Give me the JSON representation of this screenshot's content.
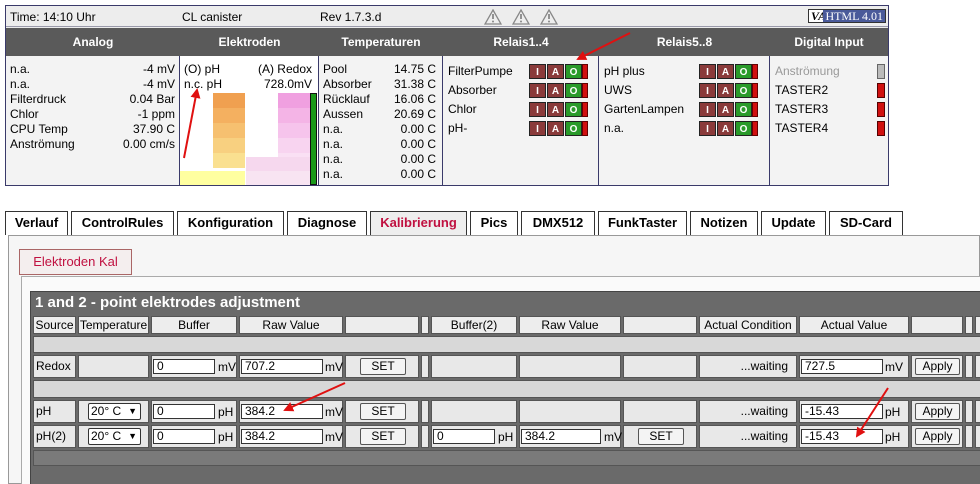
{
  "header": {
    "time": "Time: 14:10 Uhr",
    "device": "CL canister",
    "rev": "Rev 1.7.3.d",
    "badge_v": "VALIDONE",
    "badge_h": "HTML 4.01"
  },
  "panels": {
    "analog": "Analog",
    "elektroden": "Elektroden",
    "temperaturen": "Temperaturen",
    "relais14": "Relais1..4",
    "relais58": "Relais5..8",
    "digital": "Digital Input"
  },
  "analog": [
    {
      "label": "n.a.",
      "value": "-4 mV"
    },
    {
      "label": "n.a.",
      "value": "-4 mV"
    },
    {
      "label": "Filterdruck",
      "value": "0.04 Bar"
    },
    {
      "label": "Chlor",
      "value": "-1 ppm"
    },
    {
      "label": "CPU Temp",
      "value": "37.90 C"
    },
    {
      "label": "Anströmung",
      "value": "0.00 cm/s"
    }
  ],
  "elektroden": {
    "o_ph": "(O) pH",
    "a_redox": "(A) Redox",
    "nc_ph": "n.c. pH",
    "redox_value": "728.0mV"
  },
  "temperaturen": [
    {
      "label": "Pool",
      "value": "14.75 C"
    },
    {
      "label": "Absorber",
      "value": "31.38 C"
    },
    {
      "label": "Rücklauf",
      "value": "16.06 C"
    },
    {
      "label": "Aussen",
      "value": "20.69 C"
    },
    {
      "label": "n.a.",
      "value": "0.00 C"
    },
    {
      "label": "n.a.",
      "value": "0.00 C"
    },
    {
      "label": "n.a.",
      "value": "0.00 C"
    },
    {
      "label": "n.a.",
      "value": "0.00 C"
    }
  ],
  "relais14": [
    "FilterPumpe",
    "Absorber",
    "Chlor",
    "pH-"
  ],
  "relais58": [
    "pH plus",
    "UWS",
    "GartenLampen",
    "n.a."
  ],
  "iao": {
    "i": "I",
    "a": "A",
    "o": "O"
  },
  "digital": [
    {
      "label": "Anströmung",
      "active": false
    },
    {
      "label": "TASTER2",
      "active": true
    },
    {
      "label": "TASTER3",
      "active": true
    },
    {
      "label": "TASTER4",
      "active": true
    }
  ],
  "tabs": [
    "Verlauf",
    "ControlRules",
    "Konfiguration",
    "Diagnose",
    "Kalibrierung",
    "Pics",
    "DMX512",
    "FunkTaster",
    "Notizen",
    "Update",
    "SD-Card"
  ],
  "active_tab": "Kalibrierung",
  "subtab": "Elektroden Kal",
  "cal": {
    "title": "1 and 2 - point elektrodes adjustment",
    "headers": {
      "source": "Source",
      "temperature": "Temperature",
      "buffer": "Buffer",
      "raw": "Raw Value",
      "buffer2": "Buffer(2)",
      "raw2": "Raw Value",
      "actual_condition": "Actual Condition",
      "actual_value": "Actual Value"
    },
    "set_label": "SET",
    "apply_label": "Apply",
    "rows": [
      {
        "source": "Redox",
        "temp": "",
        "buffer": "0",
        "buffer_unit": "mV",
        "raw": "707.2",
        "raw_unit": "mV",
        "buffer2": "",
        "raw2": "",
        "condition": "...waiting",
        "actual": "727.5",
        "actual_unit": "mV"
      },
      {
        "source": "pH",
        "temp": "20° C",
        "buffer": "0",
        "buffer_unit": "pH",
        "raw": "384.2",
        "raw_unit": "mV",
        "buffer2": "",
        "raw2": "",
        "condition": "...waiting",
        "actual": "-15.43",
        "actual_unit": "pH"
      },
      {
        "source": "pH(2)",
        "temp": "20° C",
        "buffer": "0",
        "buffer_unit": "pH",
        "raw": "384.2",
        "raw_unit": "mV",
        "buffer2": "0",
        "buffer2_unit": "pH",
        "raw2": "384.2",
        "raw2_unit": "mV",
        "condition": "...waiting",
        "actual": "-15.43",
        "actual_unit": "pH"
      }
    ]
  },
  "colors": {
    "header_bg": "#5a5a5a",
    "accent": "#c01040",
    "led_red": "#d01010",
    "led_green": "#2a9a2a",
    "arrow": "#e01010"
  }
}
